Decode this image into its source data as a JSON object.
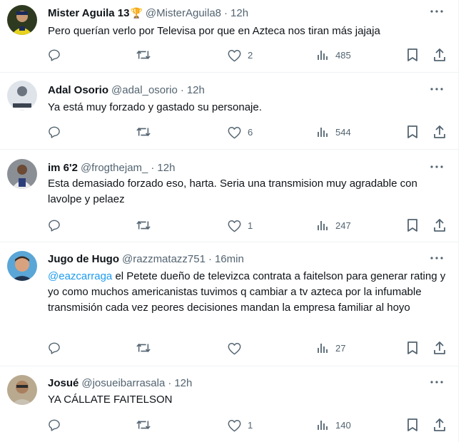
{
  "tweets": [
    {
      "name": "Mister Aguila 13",
      "badge": "🏆",
      "handle": "@MisterAguila8",
      "dot": "·",
      "time": "12h",
      "text": "Pero querían verlo por Televisa por que en Azteca nos tiran más jajaja",
      "mention": "",
      "likes": "2",
      "views": "485"
    },
    {
      "name": "Adal Osorio",
      "badge": "",
      "handle": "@adal_osorio",
      "dot": "·",
      "time": "12h",
      "text": "Ya está muy forzado y gastado su personaje.",
      "mention": "",
      "likes": "6",
      "views": "544"
    },
    {
      "name": "im 6'2",
      "badge": "",
      "handle": "@frogthejam_",
      "dot": "·",
      "time": "12h",
      "text": "Esta demasiado forzado eso, harta.  Seria una transmision muy agradable con lavolpe y pelaez",
      "mention": "",
      "likes": "1",
      "views": "247"
    },
    {
      "name": "Jugo de Hugo",
      "badge": "",
      "handle": "@razzmatazz751",
      "dot": "·",
      "time": "16min",
      "text": " el Petete dueño de televizca contrata a faitelson para generar rating y yo como muchos americanistas tuvimos q cambiar a tv azteca por la infumable transmisión cada vez peores  decisiones mandan la empresa familiar al hoyo",
      "mention": "@eazcarraga",
      "likes": "",
      "views": "27"
    },
    {
      "name": "Josué",
      "badge": "",
      "handle": "@josueibarrasala",
      "dot": "·",
      "time": "12h",
      "text": "YA CÁLLATE FAITELSON",
      "mention": "",
      "likes": "1",
      "views": "140"
    }
  ],
  "icons": {
    "reply": "reply-icon",
    "retweet": "retweet-icon",
    "like": "heart-icon",
    "views": "views-icon",
    "bookmark": "bookmark-icon",
    "share": "share-icon",
    "more": "more-icon"
  },
  "colors": {
    "text": "#0f1419",
    "secondary": "#536471",
    "link": "#1d9bf0",
    "border": "#eff3f4"
  }
}
